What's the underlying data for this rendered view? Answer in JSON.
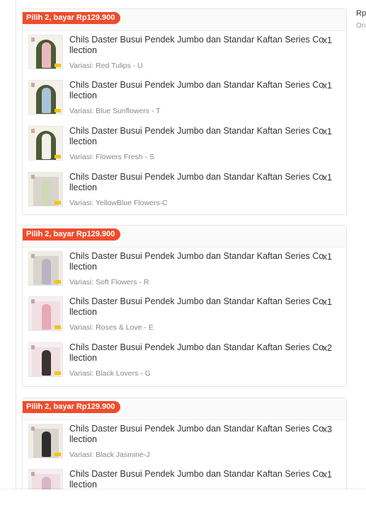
{
  "summary": {
    "price_prefix": "Rp",
    "sub_text": "On"
  },
  "groups": [
    {
      "promo": "Pilih 2, bayar Rp129.900",
      "items": [
        {
          "title": "Chils Daster Busui Pendek Jumbo dan Standar Kaftan Series Collection",
          "qty": "x1",
          "variant": "Variasi: Red Tulips - U",
          "dress_color": "#e9b9bf"
        },
        {
          "title": "Chils Daster Busui Pendek Jumbo dan Standar Kaftan Series Collection",
          "qty": "x1",
          "variant": "Variasi: Blue Sunflowers - T",
          "dress_color": "#a9c3dd"
        },
        {
          "title": "Chils Daster Busui Pendek Jumbo dan Standar Kaftan Series Collection",
          "qty": "x1",
          "variant": "Variasi: Flowers Fresh - S",
          "dress_color": "#f3f0ea"
        },
        {
          "title": "Chils Daster Busui Pendek Jumbo dan Standar Kaftan Series Collection",
          "qty": "x1",
          "variant": "Variasi: YellowBlue Flowers-C",
          "dress_color": "#cfd8b8"
        }
      ]
    },
    {
      "promo": "Pilih 2, bayar Rp129.900",
      "items": [
        {
          "title": "Chils Daster Busui Pendek Jumbo dan Standar Kaftan Series Collection",
          "qty": "x1",
          "variant": "Variasi: Soft Flowers - R",
          "dress_color": "#b9b3c4"
        },
        {
          "title": "Chils Daster Busui Pendek Jumbo dan Standar Kaftan Series Collection",
          "qty": "x1",
          "variant": "Variasi: Roses & Love - E",
          "dress_color": "#e8a8b6"
        },
        {
          "title": "Chils Daster Busui Pendek Jumbo dan Standar Kaftan Series Collection",
          "qty": "x2",
          "variant": "Variasi: Black Lovers - G",
          "dress_color": "#3a3336"
        }
      ]
    },
    {
      "promo": "Pilih 2, bayar Rp129.900",
      "items": [
        {
          "title": "Chils Daster Busui Pendek Jumbo dan Standar Kaftan Series Collection",
          "qty": "x3",
          "variant": "Variasi: Black Jasmine-J",
          "dress_color": "#2f2c30"
        },
        {
          "title": "Chils Daster Busui Pendek Jumbo dan Standar Kaftan Series Collection",
          "qty": "x1",
          "variant": "",
          "dress_color": "#d7b6c8"
        }
      ]
    }
  ]
}
